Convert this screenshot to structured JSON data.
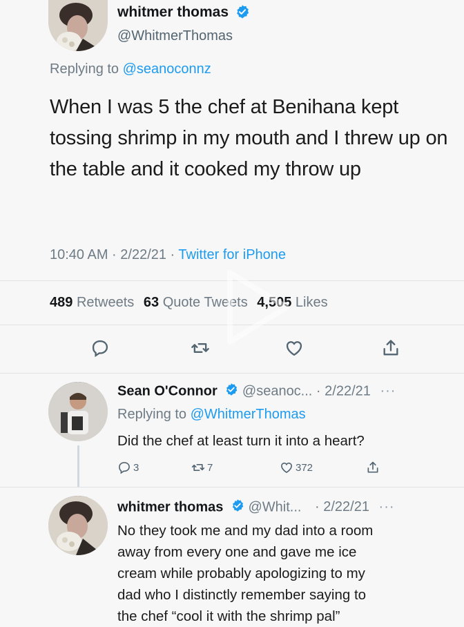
{
  "main_tweet": {
    "author_name": "whitmer thomas",
    "author_handle": "@WhitmerThomas",
    "replying_prefix": "Replying to ",
    "replying_to": "@seanoconnz",
    "text": "When I was 5 the chef at Benihana kept tossing shrimp in my mouth and I threw up on the table and it cooked my throw up",
    "time_date": "10:40 AM · 2/22/21 · ",
    "source": "Twitter for iPhone",
    "stats": {
      "retweets_count": "489",
      "retweets_label": "Retweets",
      "quotes_count": "63",
      "quotes_label": "Quote Tweets",
      "likes_count": "4,505",
      "likes_label": "Likes"
    }
  },
  "replies": [
    {
      "author_name": "Sean O'Connor",
      "author_handle": "@seanoc...",
      "date": "· 2/22/21",
      "more": "···",
      "replying_prefix": "Replying to ",
      "replying_to": "@WhitmerThomas",
      "text": "Did the chef at least turn it into a heart?",
      "counts": {
        "replies": "3",
        "retweets": "7",
        "likes": "372"
      }
    },
    {
      "author_name": "whitmer thomas",
      "author_handle": "@Whit...",
      "date": "· 2/22/21",
      "more": "···",
      "text_lines": [
        "No they took me and my dad into a room",
        "away from every one and gave me ice",
        "cream while probably apologizing to my",
        "dad who I distinctly remember saying to",
        "the chef “cool it with the shrimp pal”"
      ]
    }
  ],
  "colors": {
    "accent": "#1d9bf0",
    "secondary_text": "#6e7b85",
    "primary_text": "#14171a",
    "background": "#f7f7f7"
  },
  "icons": [
    "verified-badge-icon",
    "reply-icon",
    "retweet-icon",
    "like-icon",
    "share-icon",
    "play-icon"
  ]
}
